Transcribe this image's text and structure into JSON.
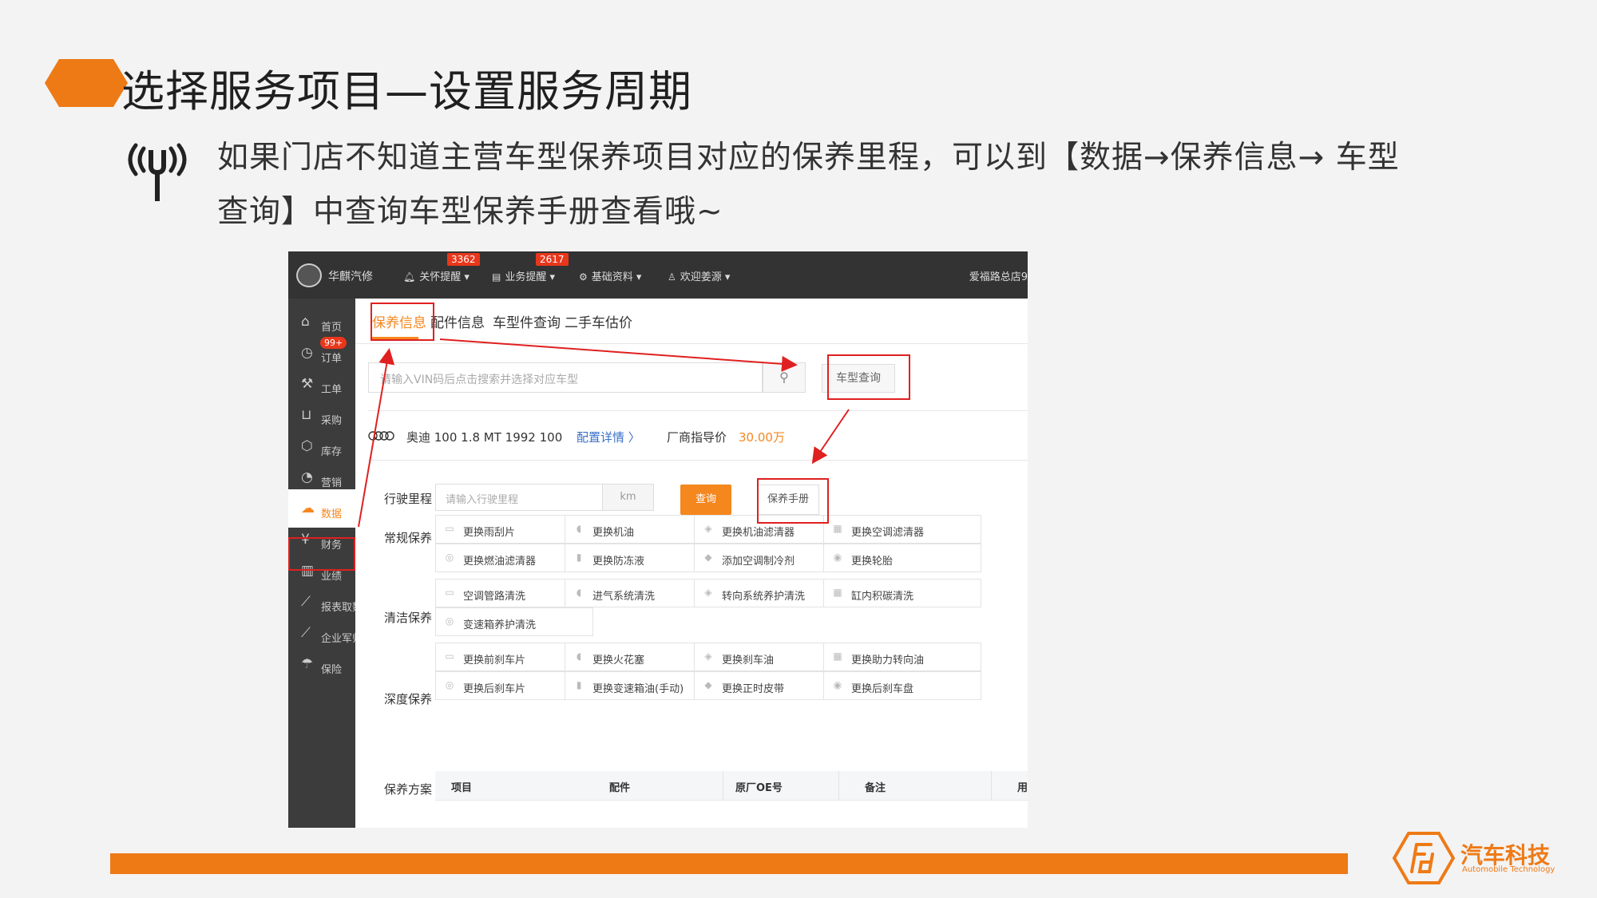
{
  "slide": {
    "title": "选择服务项目—设置服务周期",
    "description": "如果门店不知道主营车型保养项目对应的保养里程，可以到【数据→保养信息→ 车型查询】中查询车型保养手册查看哦~"
  },
  "app": {
    "logo_text": "华麒汽修",
    "nav": [
      {
        "label": "关怀提醒",
        "badge": "3362",
        "icon": "bell-icon"
      },
      {
        "label": "业务提醒",
        "badge": "2617",
        "icon": "clipboard-icon"
      },
      {
        "label": "基础资料",
        "icon": "gear-icon"
      },
      {
        "label": "欢迎姜源",
        "icon": "user-icon"
      }
    ],
    "store": "爱福路总店9",
    "sidebar": [
      {
        "label": "首页",
        "icon": "home-icon",
        "glyph": "⌂"
      },
      {
        "label": "订单",
        "icon": "clock-icon",
        "glyph": "◷",
        "badge": "99+"
      },
      {
        "label": "工单",
        "icon": "wrench-icon",
        "glyph": "⚒"
      },
      {
        "label": "采购",
        "icon": "cart-icon",
        "glyph": "⊔"
      },
      {
        "label": "库存",
        "icon": "box-icon",
        "glyph": "⬡"
      },
      {
        "label": "营销",
        "icon": "pie-icon",
        "glyph": "◔"
      },
      {
        "label": "数据",
        "icon": "cloud-icon",
        "glyph": "☁",
        "active": true
      },
      {
        "label": "财务",
        "icon": "yen-icon",
        "glyph": "¥"
      },
      {
        "label": "业绩",
        "icon": "bar-chart-icon",
        "glyph": "▥"
      },
      {
        "label": "报表取数",
        "icon": "line-chart-icon",
        "glyph": "⟋"
      },
      {
        "label": "企业军师",
        "icon": "trend-icon",
        "glyph": "⟋"
      },
      {
        "label": "保险",
        "icon": "umbrella-icon",
        "glyph": "☂"
      }
    ],
    "tabs": [
      {
        "label": "保养信息",
        "active": true
      },
      {
        "label": "配件信息"
      },
      {
        "label": "车型件查询"
      },
      {
        "label": "二手车估价"
      }
    ],
    "vin_placeholder": "请输入VIN码后点击搜索并选择对应车型",
    "model_query_label": "车型查询",
    "car": {
      "name": "奥迪 100 1.8 MT 1992 100",
      "detail_link": "配置详情 〉",
      "price_label": "厂商指导价",
      "price": "30.00万"
    },
    "mileage": {
      "label": "行驶里程",
      "placeholder": "请输入行驶里程",
      "unit": "km",
      "query_label": "查询",
      "manual_label": "保养手册"
    },
    "categories": [
      {
        "label": "常规保养",
        "items": [
          "更换雨刮片",
          "更换机油",
          "更换机油滤清器",
          "更换空调滤清器",
          "更换燃油滤清器",
          "更换防冻液",
          "添加空调制冷剂",
          "更换轮胎"
        ]
      },
      {
        "label": "清洁保养",
        "items": [
          "空调管路清洗",
          "进气系统清洗",
          "转向系统养护清洗",
          "缸内积碳清洗",
          "变速箱养护清洗"
        ]
      },
      {
        "label": "深度保养",
        "items": [
          "更换前刹车片",
          "更换火花塞",
          "更换刹车油",
          "更换助力转向油",
          "更换后刹车片",
          "更换变速箱油(手动)",
          "更换正时皮带",
          "更换后刹车盘"
        ]
      }
    ],
    "plan": {
      "label": "保养方案",
      "columns": [
        "项目",
        "配件",
        "原厂OE号",
        "备注",
        "用量"
      ]
    }
  },
  "brand": {
    "name": "汽车科技",
    "subtitle": "Automobile Technology"
  },
  "colors": {
    "accent": "#ee7a16",
    "highlight": "#e02020",
    "topbar": "#333333",
    "sidebar": "#3c3c3c"
  }
}
